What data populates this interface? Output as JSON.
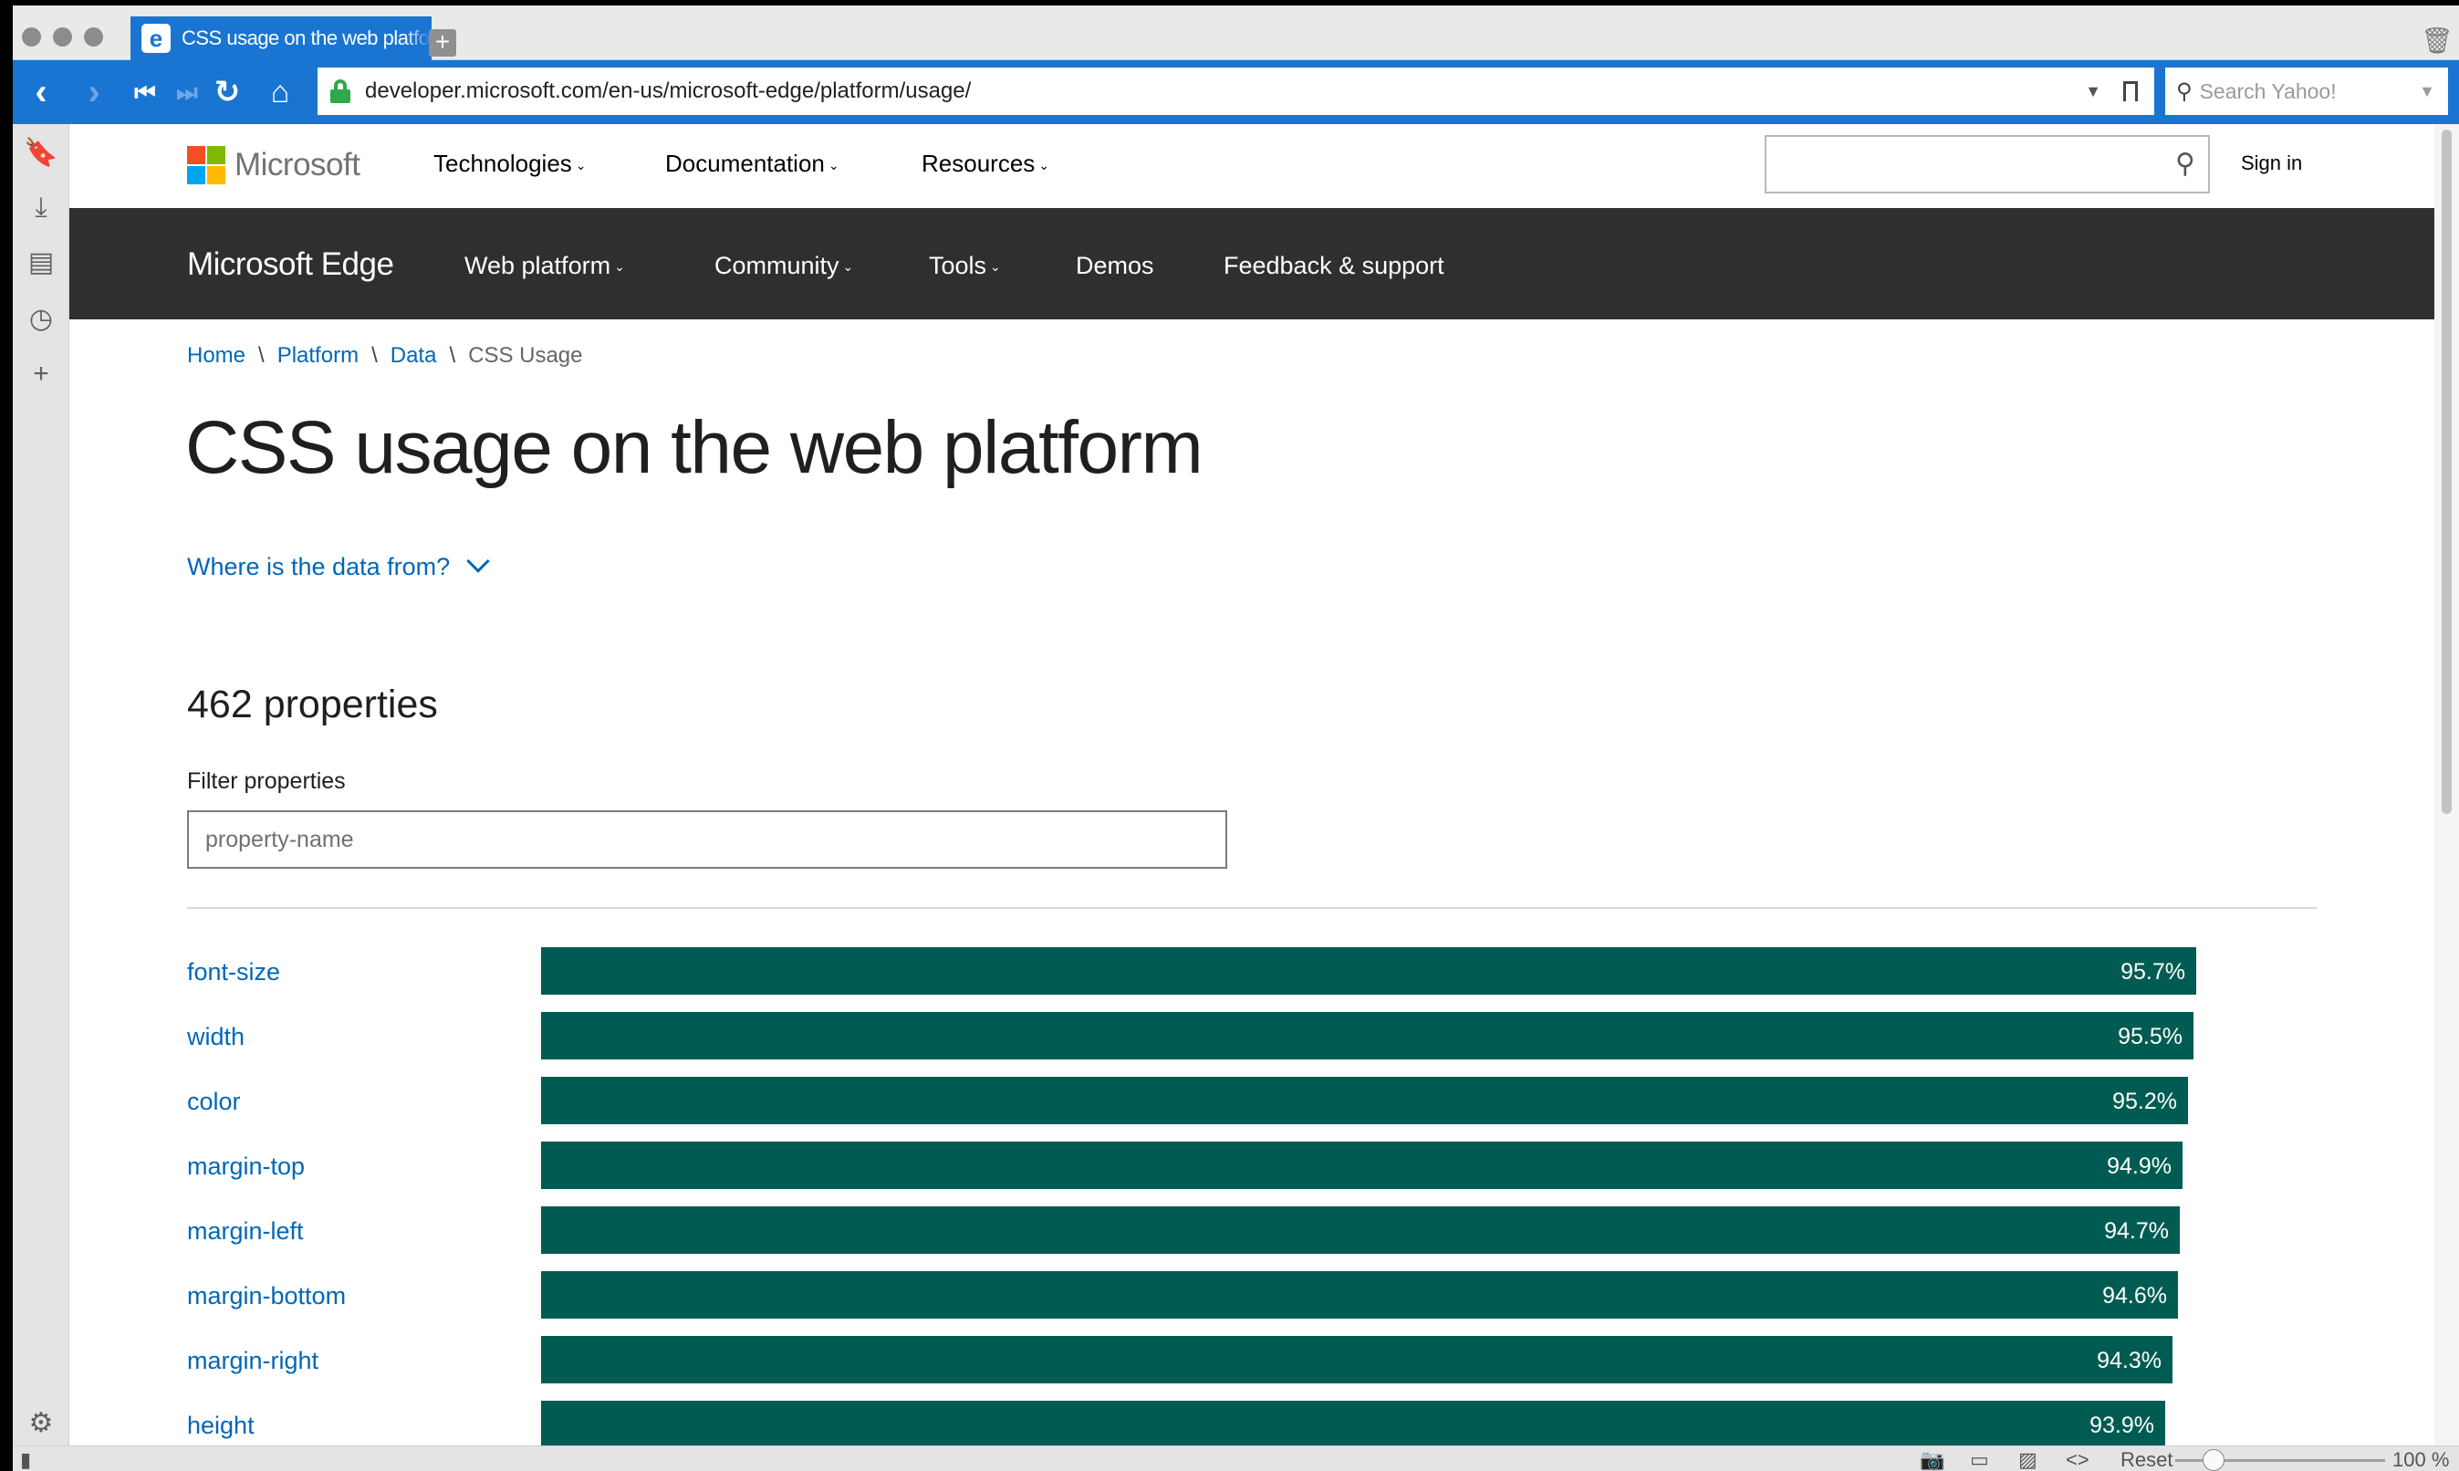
{
  "browser": {
    "tab_title": "CSS usage on the web platfo",
    "url": "developer.microsoft.com/en-us/microsoft-edge/platform/usage/",
    "search_placeholder": "Search Yahoo!",
    "status": {
      "reset_label": "Reset",
      "zoom_level": "100 %"
    },
    "accent_color": "#1a74d2"
  },
  "site_header": {
    "brand": "Microsoft",
    "nav": [
      "Technologies",
      "Documentation",
      "Resources"
    ],
    "sign_in": "Sign in"
  },
  "edge_nav": {
    "title": "Microsoft Edge",
    "items": [
      "Web platform",
      "Community",
      "Tools",
      "Demos",
      "Feedback & support"
    ]
  },
  "breadcrumb": [
    "Home",
    "Platform",
    "Data",
    "CSS Usage"
  ],
  "page": {
    "title": "CSS usage on the web platform",
    "data_source_toggle": "Where is the data from?",
    "property_count": "462 properties",
    "filter_label": "Filter properties",
    "filter_placeholder": "property-name"
  },
  "chart_data": {
    "type": "bar",
    "orientation": "horizontal",
    "bar_color": "#005c52",
    "xlim": [
      0,
      100
    ],
    "categories": [
      "font-size",
      "width",
      "color",
      "margin-top",
      "margin-left",
      "margin-bottom",
      "margin-right",
      "height"
    ],
    "values": [
      95.7,
      95.5,
      95.2,
      94.9,
      94.7,
      94.6,
      94.3,
      93.9
    ],
    "value_labels": [
      "95.7%",
      "95.5%",
      "95.2%",
      "94.9%",
      "94.7%",
      "94.6%",
      "94.3%",
      "93.9%"
    ]
  }
}
